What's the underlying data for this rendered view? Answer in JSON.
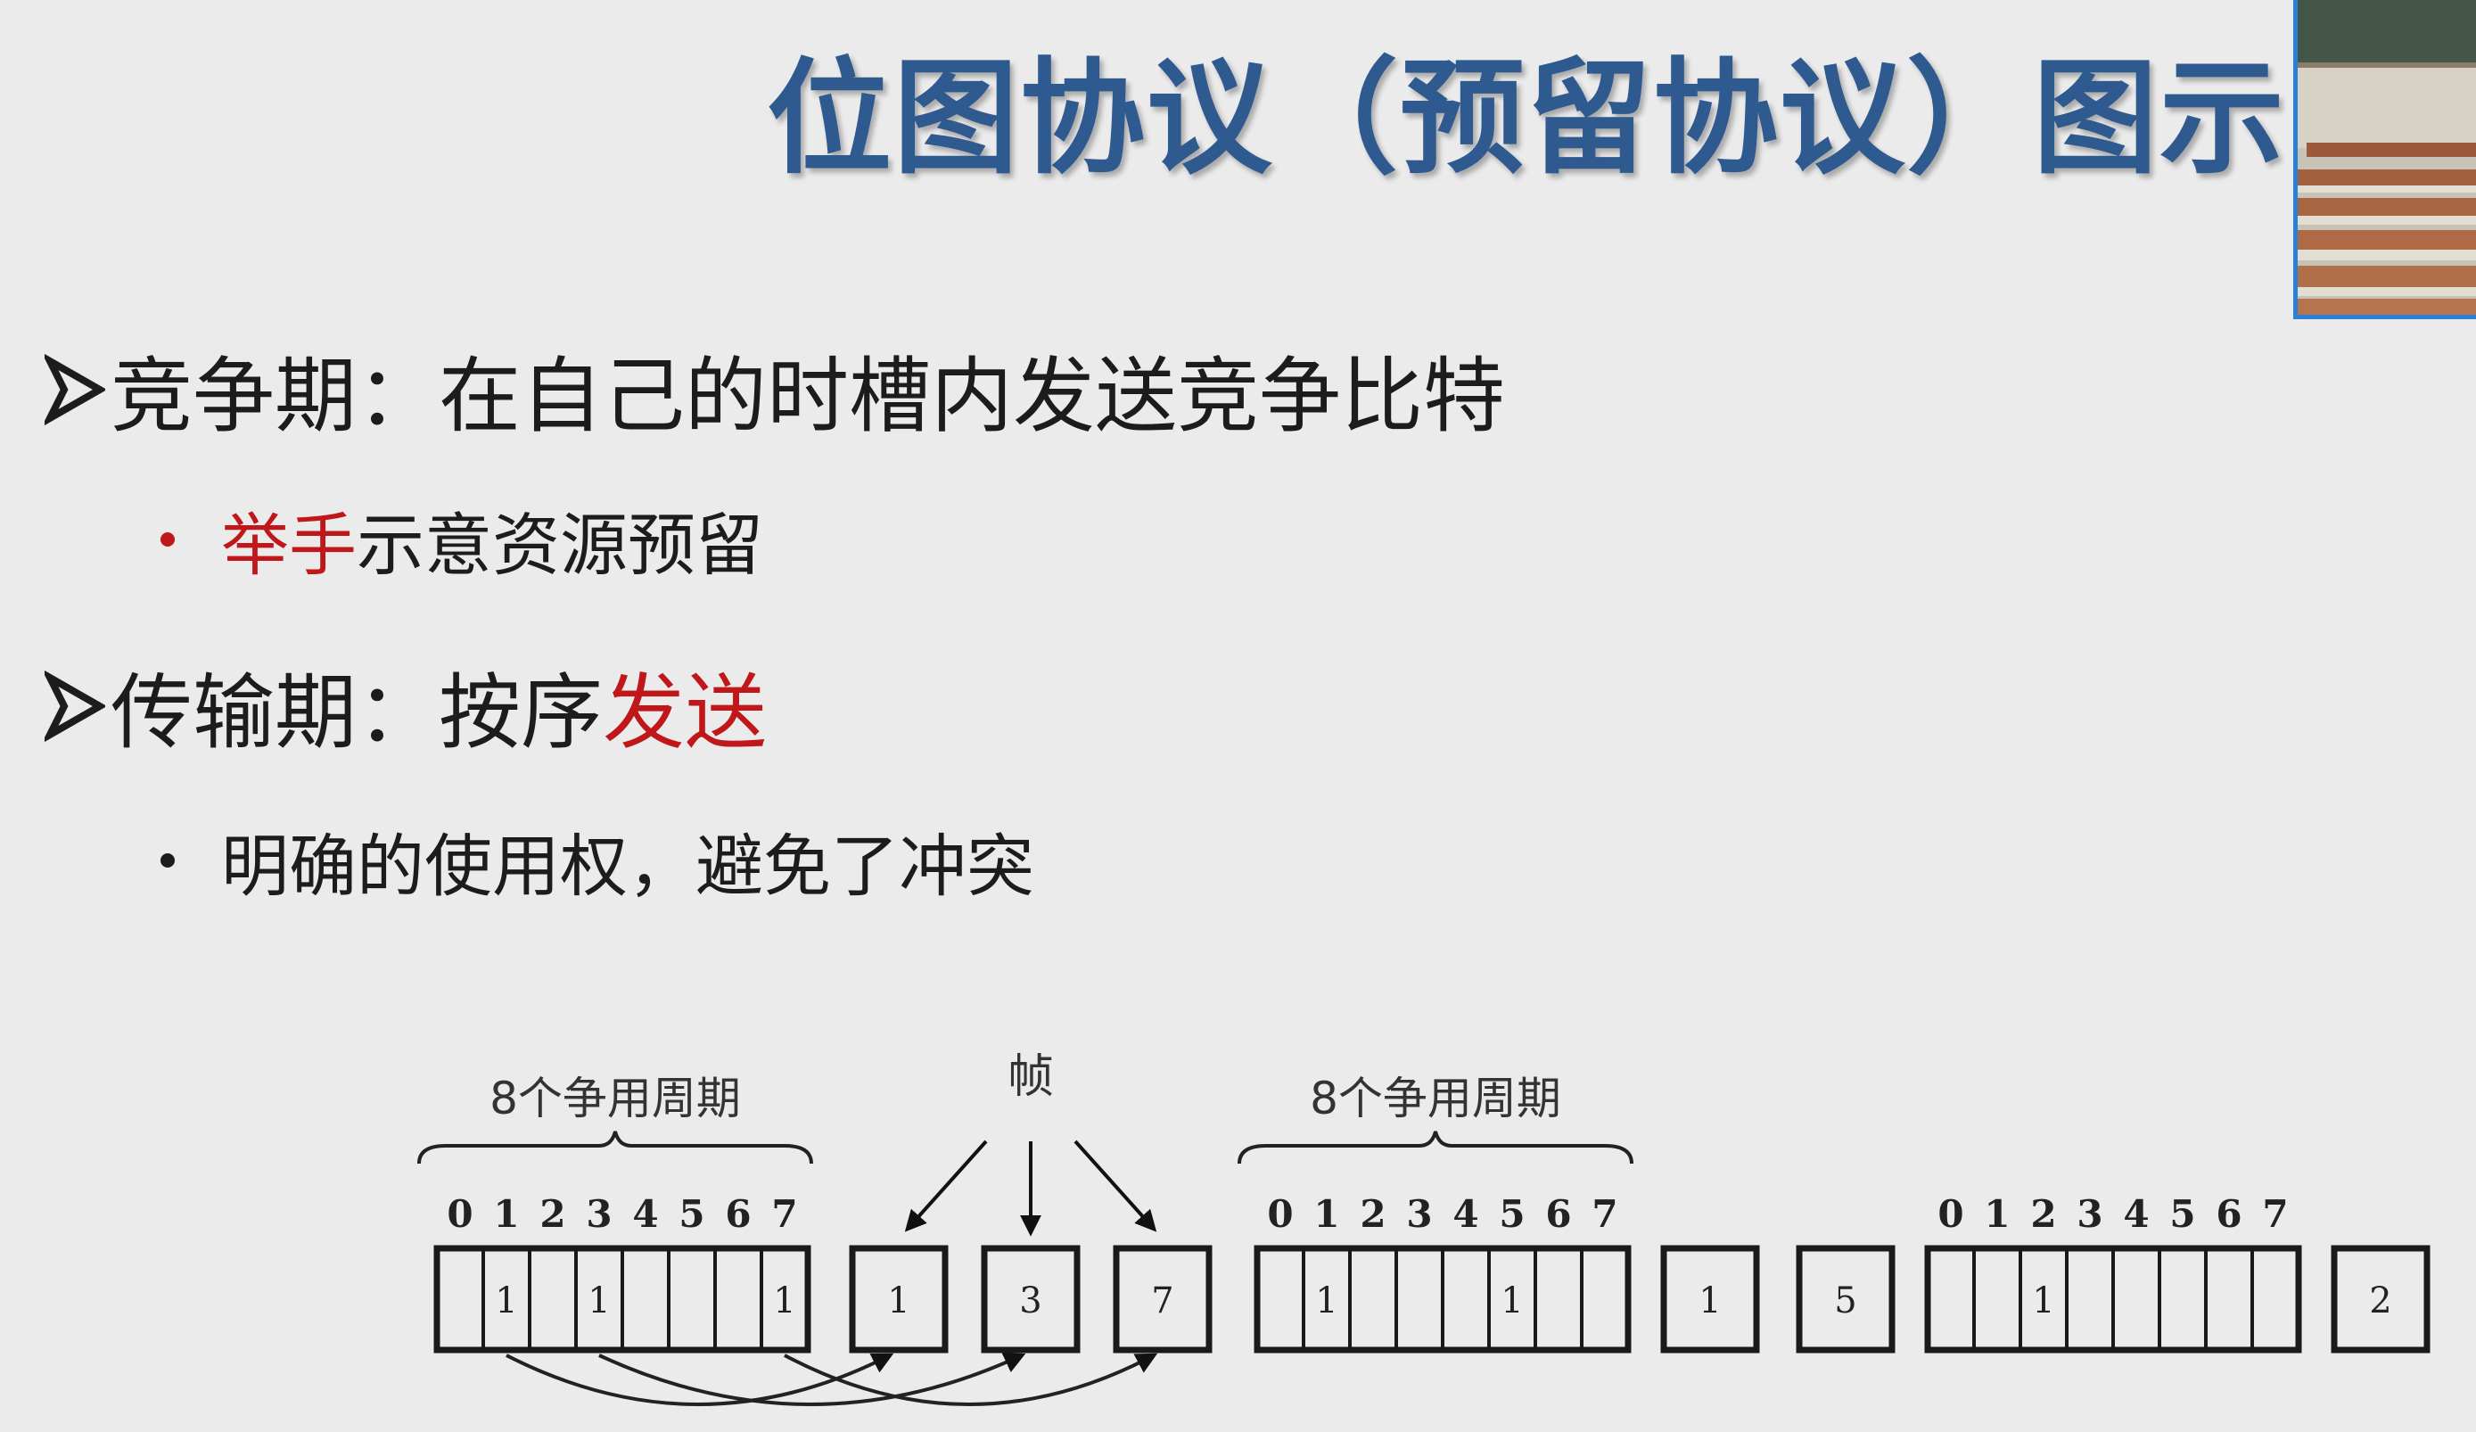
{
  "slide": {
    "title": "位图协议（预留协议）图示",
    "bullets": [
      {
        "level": 1,
        "parts": [
          {
            "text": "竞争期：在自己的时槽内发送竞争比特",
            "color": "#1c1c1c"
          }
        ]
      },
      {
        "level": 2,
        "dot_color": "#c0171b",
        "parts": [
          {
            "text": "举手",
            "color": "#c0171b"
          },
          {
            "text": "示意资源预留",
            "color": "#1c1c1c"
          }
        ]
      },
      {
        "level": 1,
        "parts": [
          {
            "text": "传输期：按序",
            "color": "#1c1c1c"
          },
          {
            "text": "发送",
            "color": "#c0171b"
          }
        ]
      },
      {
        "level": 2,
        "dot_color": "#1c1c1c",
        "parts": [
          {
            "text": "明确的使用权，避免了冲突",
            "color": "#1c1c1c"
          }
        ]
      }
    ]
  },
  "diagram": {
    "contention_label": "8个争用周期",
    "frames_label": "帧",
    "slot_numbers": [
      "0",
      "1",
      "2",
      "3",
      "4",
      "5",
      "6",
      "7"
    ],
    "groups": [
      {
        "type": "contention",
        "bits": [
          "",
          "1",
          "",
          "1",
          "",
          "",
          "",
          "1"
        ],
        "brace": true
      },
      {
        "type": "frame",
        "label": "1"
      },
      {
        "type": "frame",
        "label": "3"
      },
      {
        "type": "frame",
        "label": "7"
      },
      {
        "type": "contention",
        "bits": [
          "",
          "1",
          "",
          "",
          "",
          "1",
          "",
          ""
        ],
        "brace": true
      },
      {
        "type": "frame",
        "label": "1"
      },
      {
        "type": "frame",
        "label": "5"
      },
      {
        "type": "contention",
        "bits": [
          "",
          "",
          "1",
          "",
          "",
          "",
          "",
          ""
        ],
        "brace": false
      },
      {
        "type": "frame",
        "label": "2"
      }
    ]
  },
  "colors": {
    "title": "#2e5a8f",
    "text": "#1c1c1c",
    "highlight": "#c0171b",
    "webcam_border": "#2a7fd6"
  }
}
